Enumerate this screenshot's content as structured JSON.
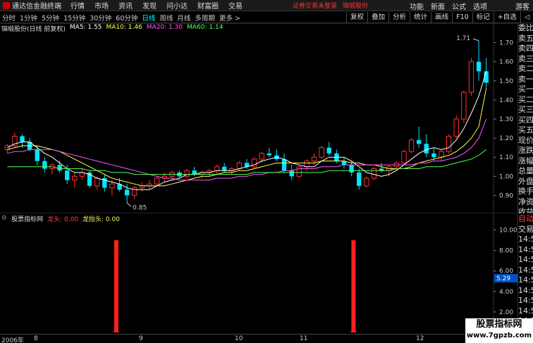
{
  "menubar": {
    "app_title": "通达信金融终端",
    "items": [
      "行情",
      "市场",
      "资讯",
      "发现",
      "问小达",
      "财富圈",
      "交易"
    ],
    "notice_1": "证券交易未登录",
    "notice_2": "锦缎股份",
    "right_items": [
      "功能",
      "新面",
      "公式",
      "选项"
    ],
    "guest": "游客"
  },
  "toolbar": {
    "periods": [
      "分时",
      "1分钟",
      "5分钟",
      "15分钟",
      "30分钟",
      "60分钟",
      "日线",
      "周线",
      "月线",
      "多周期",
      "更多 >"
    ],
    "active_period": "日线",
    "buttons": [
      "复权",
      "叠加",
      "分析",
      "统计",
      "画线",
      "F10",
      "标记",
      "+自选",
      "◁"
    ]
  },
  "legend": {
    "stock_name": "锦缎股份(日线 前复权)",
    "ma5": "MA5: 1.55",
    "ma10": "MA10: 1.46",
    "ma20": "MA20: 1.30",
    "ma60": "MA60: 1.14"
  },
  "indicator_legend": {
    "name": "股票指标网",
    "line1": "龙头: 0.00",
    "line2": "龙抬头: 0.00"
  },
  "side_panel": {
    "main": [
      "委比",
      "卖五",
      "卖四",
      "卖三",
      "卖二",
      "卖一",
      "买一",
      "买二",
      "买三",
      "买四",
      "买五",
      "现价",
      "涨跌",
      "涨幅",
      "总量",
      "外盘",
      "换手",
      "净资",
      "收益"
    ],
    "lower": [
      "自动",
      "交易",
      "14:50",
      "14:50",
      "14:50",
      "14:50",
      "14:50",
      "14:50",
      "14:50",
      "14:50",
      "14:50"
    ]
  },
  "date_axis": {
    "labels": [
      "2006年",
      "8",
      "9",
      "10",
      "11",
      "12"
    ]
  },
  "watermark": {
    "line1": "股票指标网",
    "line2": "www.7gpzb.com"
  },
  "chart_data": [
    {
      "type": "candlestick",
      "title": "锦缎股份(日线 前复权)",
      "ylim": [
        0.85,
        1.75
      ],
      "y_ticks": [
        "1.70",
        "1.60",
        "1.50",
        "1.40",
        "1.30",
        "1.20",
        "1.10",
        "1.00",
        "0.90"
      ],
      "annotations": {
        "high": "1.71",
        "low": "0.85"
      },
      "candles": [
        [
          1.14,
          1.17,
          1.12,
          1.16
        ],
        [
          1.16,
          1.23,
          1.15,
          1.21
        ],
        [
          1.21,
          1.22,
          1.15,
          1.18
        ],
        [
          1.18,
          1.2,
          1.13,
          1.14
        ],
        [
          1.14,
          1.16,
          1.06,
          1.08
        ],
        [
          1.08,
          1.1,
          1.02,
          1.04
        ],
        [
          1.04,
          1.07,
          1.01,
          1.06
        ],
        [
          1.06,
          1.08,
          1.02,
          1.03
        ],
        [
          1.03,
          1.06,
          0.96,
          0.98
        ],
        [
          0.98,
          1.02,
          0.94,
          1.0
        ],
        [
          1.0,
          1.04,
          0.98,
          1.02
        ],
        [
          1.02,
          1.03,
          0.94,
          0.95
        ],
        [
          0.95,
          1.0,
          0.93,
          0.99
        ],
        [
          0.99,
          1.01,
          0.92,
          0.94
        ],
        [
          0.94,
          0.98,
          0.9,
          0.96
        ],
        [
          0.96,
          0.99,
          0.92,
          0.93
        ],
        [
          0.93,
          0.96,
          0.86,
          0.9
        ],
        [
          0.9,
          0.95,
          0.88,
          0.94
        ],
        [
          0.94,
          0.97,
          0.92,
          0.95
        ],
        [
          0.95,
          0.98,
          0.93,
          0.96
        ],
        [
          0.96,
          1.0,
          0.95,
          0.99
        ],
        [
          0.99,
          1.02,
          0.97,
          1.0
        ],
        [
          1.0,
          1.03,
          0.98,
          1.02
        ],
        [
          1.02,
          1.03,
          0.99,
          1.0
        ],
        [
          1.0,
          1.04,
          0.99,
          1.03
        ],
        [
          1.03,
          1.05,
          1.0,
          1.01
        ],
        [
          1.01,
          1.03,
          0.99,
          1.02
        ],
        [
          1.02,
          1.04,
          1.0,
          1.03
        ],
        [
          1.03,
          1.06,
          1.01,
          1.05
        ],
        [
          1.05,
          1.07,
          1.02,
          1.03
        ],
        [
          1.03,
          1.05,
          1.01,
          1.04
        ],
        [
          1.04,
          1.08,
          1.03,
          1.07
        ],
        [
          1.07,
          1.09,
          1.04,
          1.05
        ],
        [
          1.05,
          1.1,
          1.04,
          1.09
        ],
        [
          1.09,
          1.13,
          1.07,
          1.12
        ],
        [
          1.12,
          1.15,
          1.1,
          1.11
        ],
        [
          1.11,
          1.14,
          1.08,
          1.09
        ],
        [
          1.09,
          1.12,
          1.02,
          1.03
        ],
        [
          1.03,
          1.06,
          0.98,
          1.0
        ],
        [
          1.0,
          1.06,
          0.99,
          1.05
        ],
        [
          1.05,
          1.09,
          1.03,
          1.08
        ],
        [
          1.08,
          1.12,
          1.06,
          1.1
        ],
        [
          1.1,
          1.16,
          1.09,
          1.15
        ],
        [
          1.15,
          1.18,
          1.11,
          1.12
        ],
        [
          1.12,
          1.14,
          1.07,
          1.08
        ],
        [
          1.08,
          1.1,
          1.04,
          1.06
        ],
        [
          1.06,
          1.08,
          1.0,
          1.02
        ],
        [
          1.02,
          1.04,
          0.93,
          0.95
        ],
        [
          0.95,
          1.0,
          0.94,
          0.99
        ],
        [
          0.99,
          1.05,
          0.98,
          1.04
        ],
        [
          1.04,
          1.07,
          1.02,
          1.03
        ],
        [
          1.03,
          1.06,
          1.0,
          1.05
        ],
        [
          1.05,
          1.08,
          1.03,
          1.07
        ],
        [
          1.07,
          1.14,
          1.06,
          1.13
        ],
        [
          1.13,
          1.2,
          1.12,
          1.19
        ],
        [
          1.19,
          1.26,
          1.15,
          1.17
        ],
        [
          1.17,
          1.22,
          1.1,
          1.12
        ],
        [
          1.12,
          1.15,
          1.08,
          1.1
        ],
        [
          1.1,
          1.14,
          1.08,
          1.13
        ],
        [
          1.13,
          1.22,
          1.12,
          1.21
        ],
        [
          1.21,
          1.32,
          1.2,
          1.3
        ],
        [
          1.3,
          1.45,
          1.28,
          1.44
        ],
        [
          1.44,
          1.62,
          1.42,
          1.6
        ],
        [
          1.6,
          1.71,
          1.5,
          1.55
        ],
        [
          1.55,
          1.62,
          1.46,
          1.49
        ]
      ],
      "ma_lines": [
        {
          "name": "MA5",
          "color": "#ffffff",
          "values": [
            1.15,
            1.17,
            1.18,
            1.18,
            1.15,
            1.12,
            1.1,
            1.07,
            1.04,
            1.02,
            1.02,
            1.01,
            0.99,
            0.98,
            0.97,
            0.96,
            0.94,
            0.93,
            0.93,
            0.93,
            0.95,
            0.97,
            0.98,
            0.99,
            1.01,
            1.01,
            1.02,
            1.02,
            1.03,
            1.03,
            1.03,
            1.04,
            1.05,
            1.06,
            1.08,
            1.09,
            1.1,
            1.09,
            1.07,
            1.06,
            1.05,
            1.05,
            1.08,
            1.1,
            1.1,
            1.1,
            1.08,
            1.05,
            1.02,
            1.01,
            1.0,
            1.01,
            1.03,
            1.06,
            1.09,
            1.12,
            1.14,
            1.15,
            1.14,
            1.15,
            1.19,
            1.25,
            1.33,
            1.42,
            1.55
          ]
        },
        {
          "name": "MA10",
          "color": "#ffff55",
          "values": [
            1.14,
            1.15,
            1.16,
            1.16,
            1.16,
            1.15,
            1.14,
            1.13,
            1.11,
            1.09,
            1.07,
            1.05,
            1.03,
            1.01,
            0.99,
            0.98,
            0.97,
            0.96,
            0.95,
            0.95,
            0.95,
            0.95,
            0.96,
            0.97,
            0.98,
            0.99,
            1.0,
            1.0,
            1.01,
            1.02,
            1.02,
            1.03,
            1.03,
            1.04,
            1.05,
            1.06,
            1.07,
            1.07,
            1.07,
            1.07,
            1.07,
            1.07,
            1.08,
            1.08,
            1.08,
            1.08,
            1.07,
            1.07,
            1.06,
            1.06,
            1.05,
            1.04,
            1.04,
            1.04,
            1.05,
            1.07,
            1.08,
            1.09,
            1.1,
            1.11,
            1.13,
            1.16,
            1.2,
            1.26,
            1.46
          ]
        },
        {
          "name": "MA20",
          "color": "#ff55ff",
          "values": [
            1.12,
            1.13,
            1.13,
            1.14,
            1.14,
            1.14,
            1.14,
            1.13,
            1.12,
            1.11,
            1.1,
            1.09,
            1.08,
            1.07,
            1.06,
            1.05,
            1.04,
            1.03,
            1.02,
            1.01,
            1.0,
            0.99,
            0.99,
            0.98,
            0.98,
            0.98,
            0.98,
            0.98,
            0.99,
            0.99,
            0.99,
            1.0,
            1.0,
            1.01,
            1.01,
            1.02,
            1.02,
            1.03,
            1.03,
            1.04,
            1.04,
            1.04,
            1.05,
            1.05,
            1.05,
            1.06,
            1.06,
            1.06,
            1.06,
            1.06,
            1.06,
            1.06,
            1.06,
            1.06,
            1.06,
            1.07,
            1.07,
            1.08,
            1.08,
            1.09,
            1.1,
            1.12,
            1.15,
            1.2,
            1.3
          ]
        },
        {
          "name": "MA60",
          "color": "#55ff55",
          "values": [
            1.05,
            1.05,
            1.05,
            1.05,
            1.05,
            1.05,
            1.05,
            1.04,
            1.04,
            1.04,
            1.04,
            1.03,
            1.03,
            1.03,
            1.02,
            1.02,
            1.02,
            1.01,
            1.01,
            1.01,
            1.01,
            1.01,
            1.01,
            1.01,
            1.01,
            1.01,
            1.01,
            1.01,
            1.01,
            1.01,
            1.01,
            1.01,
            1.01,
            1.02,
            1.02,
            1.02,
            1.02,
            1.02,
            1.02,
            1.02,
            1.02,
            1.02,
            1.02,
            1.03,
            1.03,
            1.03,
            1.03,
            1.03,
            1.03,
            1.03,
            1.03,
            1.03,
            1.04,
            1.04,
            1.04,
            1.04,
            1.05,
            1.05,
            1.05,
            1.06,
            1.07,
            1.08,
            1.09,
            1.11,
            1.14
          ]
        }
      ]
    },
    {
      "type": "bar",
      "title": "股票指标网",
      "ylim": [
        0,
        11
      ],
      "y_ticks": [
        "10.00",
        "8.00",
        "6.00",
        "4.00",
        "2.00"
      ],
      "current_value": "5.29",
      "series": [
        {
          "name": "龙头",
          "color": "#ff2020",
          "bars": [
            {
              "index": 24,
              "value": 9
            },
            {
              "index": 74,
              "value": 9
            }
          ]
        }
      ],
      "bar_count": 104
    }
  ]
}
